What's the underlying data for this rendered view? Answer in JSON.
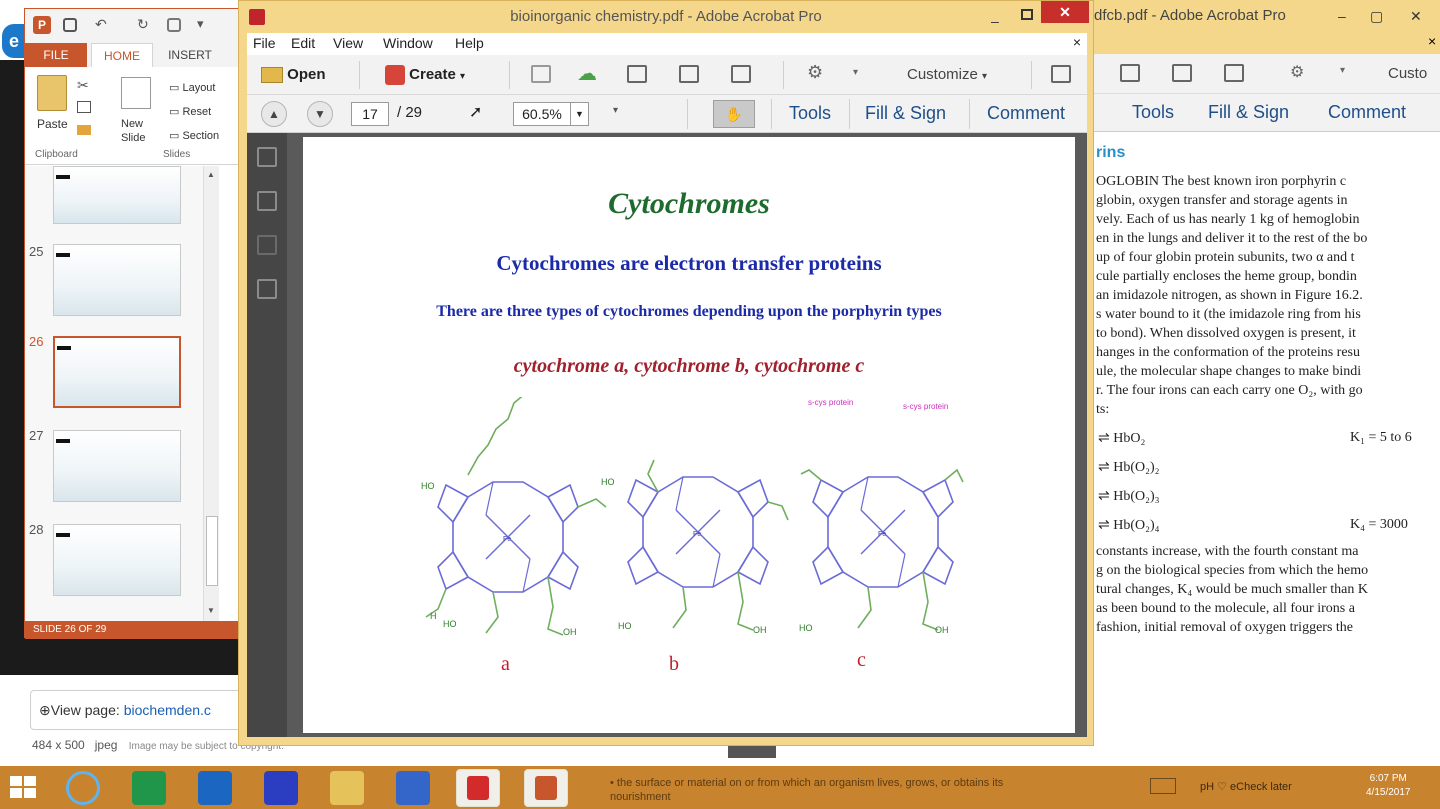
{
  "acrobat": {
    "title": "bioinorganic chemistry.pdf - Adobe Acrobat Pro",
    "menu": [
      "File",
      "Edit",
      "View",
      "Window",
      "Help"
    ],
    "toolbar": {
      "open_label": "Open",
      "create_label": "Create",
      "customize_label": "Customize"
    },
    "nav": {
      "current_page": "17",
      "total_pages": "/ 29",
      "zoom": "60.5%"
    },
    "panes": {
      "tools_label": "Tools",
      "fill_sign_label": "Fill & Sign",
      "comment_label": "Comment"
    },
    "page": {
      "title": "Cytochromes",
      "subtitle1": "Cytochromes are electron transfer proteins",
      "subtitle2": "There are three types of cytochromes depending upon the porphyrin types",
      "subtitle3": "cytochrome a, cytochrome b, cytochrome c",
      "structure_labels": [
        "a",
        "b",
        "c"
      ],
      "cys_label": "s-cys protein",
      "atom_labels": {
        "ho": "HO",
        "oh": "OH",
        "n": "N",
        "fe": "Fe",
        "h": "H"
      }
    }
  },
  "acrobat_bg": {
    "title": "dfcb.pdf - Adobe Acrobat Pro",
    "panes": {
      "tools_label": "Tools",
      "fill_sign_label": "Fill & Sign",
      "comment_label": "Comment",
      "customize_label": "Custo"
    },
    "text_lines": [
      "rins",
      "OGLOBIN  The best known iron porphyrin c",
      "globin, oxygen transfer and storage agents in",
      "vely. Each of us has nearly 1 kg of hemoglobin",
      "en in the lungs and deliver it to the rest of the bo",
      "up of four globin protein subunits, two α and t",
      "cule partially encloses the heme group, bondin",
      "an imidazole nitrogen, as shown in Figure 16.2.",
      "s water bound to it (the imidazole ring from his",
      "to bond). When dissolved oxygen is present, it",
      "hanges in the conformation of the proteins resu",
      "ule, the molecular shape changes to make bindi",
      "r. The four irons can each carry one O₂, with go",
      "ts:"
    ],
    "equilibria": [
      {
        "species": "⇌ HbO₂",
        "constant": "K₁ = 5 to 6"
      },
      {
        "species": "⇌ Hb(O₂)₂",
        "constant": ""
      },
      {
        "species": "⇌ Hb(O₂)₃",
        "constant": ""
      },
      {
        "species": "⇌ Hb(O₂)₄",
        "constant": "K₄ = 3000"
      }
    ],
    "text_lines_2": [
      "constants increase, with the fourth constant ma",
      "g on the biological species from which the hemo",
      "tural changes, K₄ would be much smaller than K",
      "as been bound to the molecule, all four irons a",
      "fashion, initial removal of oxygen triggers the"
    ]
  },
  "powerpoint": {
    "tabs": {
      "file": "FILE",
      "home": "HOME",
      "insert": "INSERT"
    },
    "ribbon": {
      "paste_label": "Paste",
      "new_slide_label": "New Slide",
      "layout_label": "Layout",
      "reset_label": "Reset",
      "section_label": "Section",
      "clipboard_label": "Clipboard",
      "slides_label": "Slides"
    },
    "slide_numbers": [
      "25",
      "26",
      "27",
      "28"
    ],
    "selected_slide": "26",
    "status": "SLIDE 26 OF 29"
  },
  "browser_bg": {
    "view_page_label": "View page:",
    "view_page_link": "biochemden.c",
    "image_size": "484 x 500",
    "image_type": "jpeg",
    "image_note": "Image may be subject to copyright."
  },
  "taskbar": {
    "tooltip_line1": "the surface or material on or from which an organism lives, grows, or obtains its",
    "tooltip_line2": "nourishment",
    "tray_text": "pH ♡ eCheck later",
    "time": "6:07 PM",
    "date": "4/15/2017"
  },
  "colors": {
    "acrobat_frame": "#f5d78b",
    "ppt_accent": "#c8562c",
    "taskbar": "#c8832e",
    "title_green": "#1e6b2e",
    "subtitle_blue": "#1a2aa8",
    "subtitle_red": "#a0202c"
  }
}
